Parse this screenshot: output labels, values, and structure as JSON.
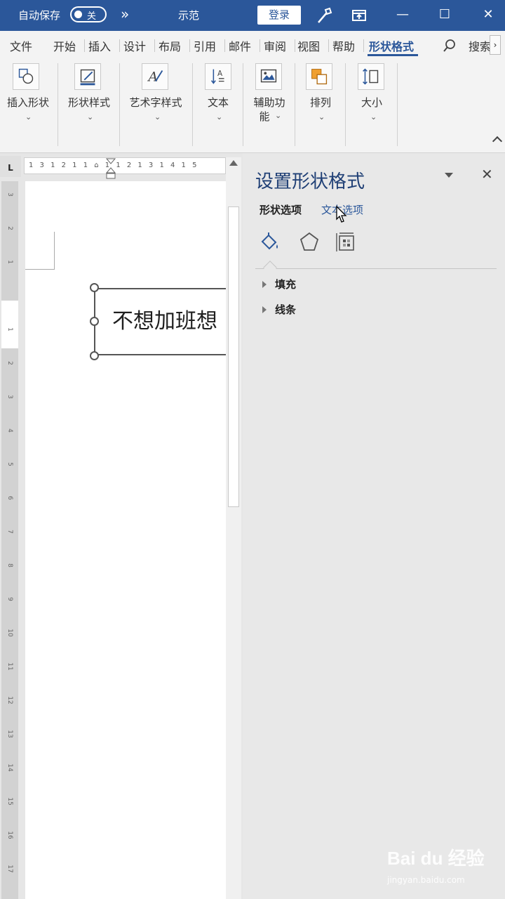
{
  "titlebar": {
    "autosave_label": "自动保存",
    "autosave_state": "关",
    "more_symbol": "»",
    "doc_title": "示范",
    "login_label": "登录",
    "min_symbol": "—",
    "restore_symbol": "☐",
    "close_symbol": "✕"
  },
  "tabs": [
    "文件",
    "开始",
    "插入",
    "设计",
    "布局",
    "引用",
    "邮件",
    "审阅",
    "视图",
    "帮助",
    "形状格式"
  ],
  "search_label": "搜索",
  "ribbon": {
    "groups": [
      {
        "label": "插入形状"
      },
      {
        "label": "形状样式"
      },
      {
        "label": "艺术字样式"
      },
      {
        "label": "文本"
      },
      {
        "label_line1": "辅助功",
        "label_line2": "能"
      },
      {
        "label": "排列"
      },
      {
        "label": "大小"
      }
    ]
  },
  "ruler": {
    "corner": "L",
    "h_text": "1 3 1 2 1 1 ⌂ 1 1 2 1 3 1 4 1 5",
    "v_numbers": [
      "3",
      "2",
      "1",
      "1",
      "2",
      "3",
      "4",
      "5",
      "6",
      "7",
      "8",
      "9",
      "10",
      "11",
      "12",
      "13",
      "14",
      "15",
      "16",
      "17"
    ]
  },
  "document": {
    "shape_text": "不想加班想"
  },
  "pane": {
    "title": "设置形状格式",
    "close_symbol": "✕",
    "tab_shape": "形状选项",
    "tab_text": "文本选项",
    "sections": [
      "填充",
      "线条"
    ]
  },
  "watermark": {
    "main": "Bai du 经验",
    "sub": "jingyan.baidu.com"
  },
  "colors": {
    "accent": "#2b579a",
    "pane_title": "#1f3f75"
  }
}
